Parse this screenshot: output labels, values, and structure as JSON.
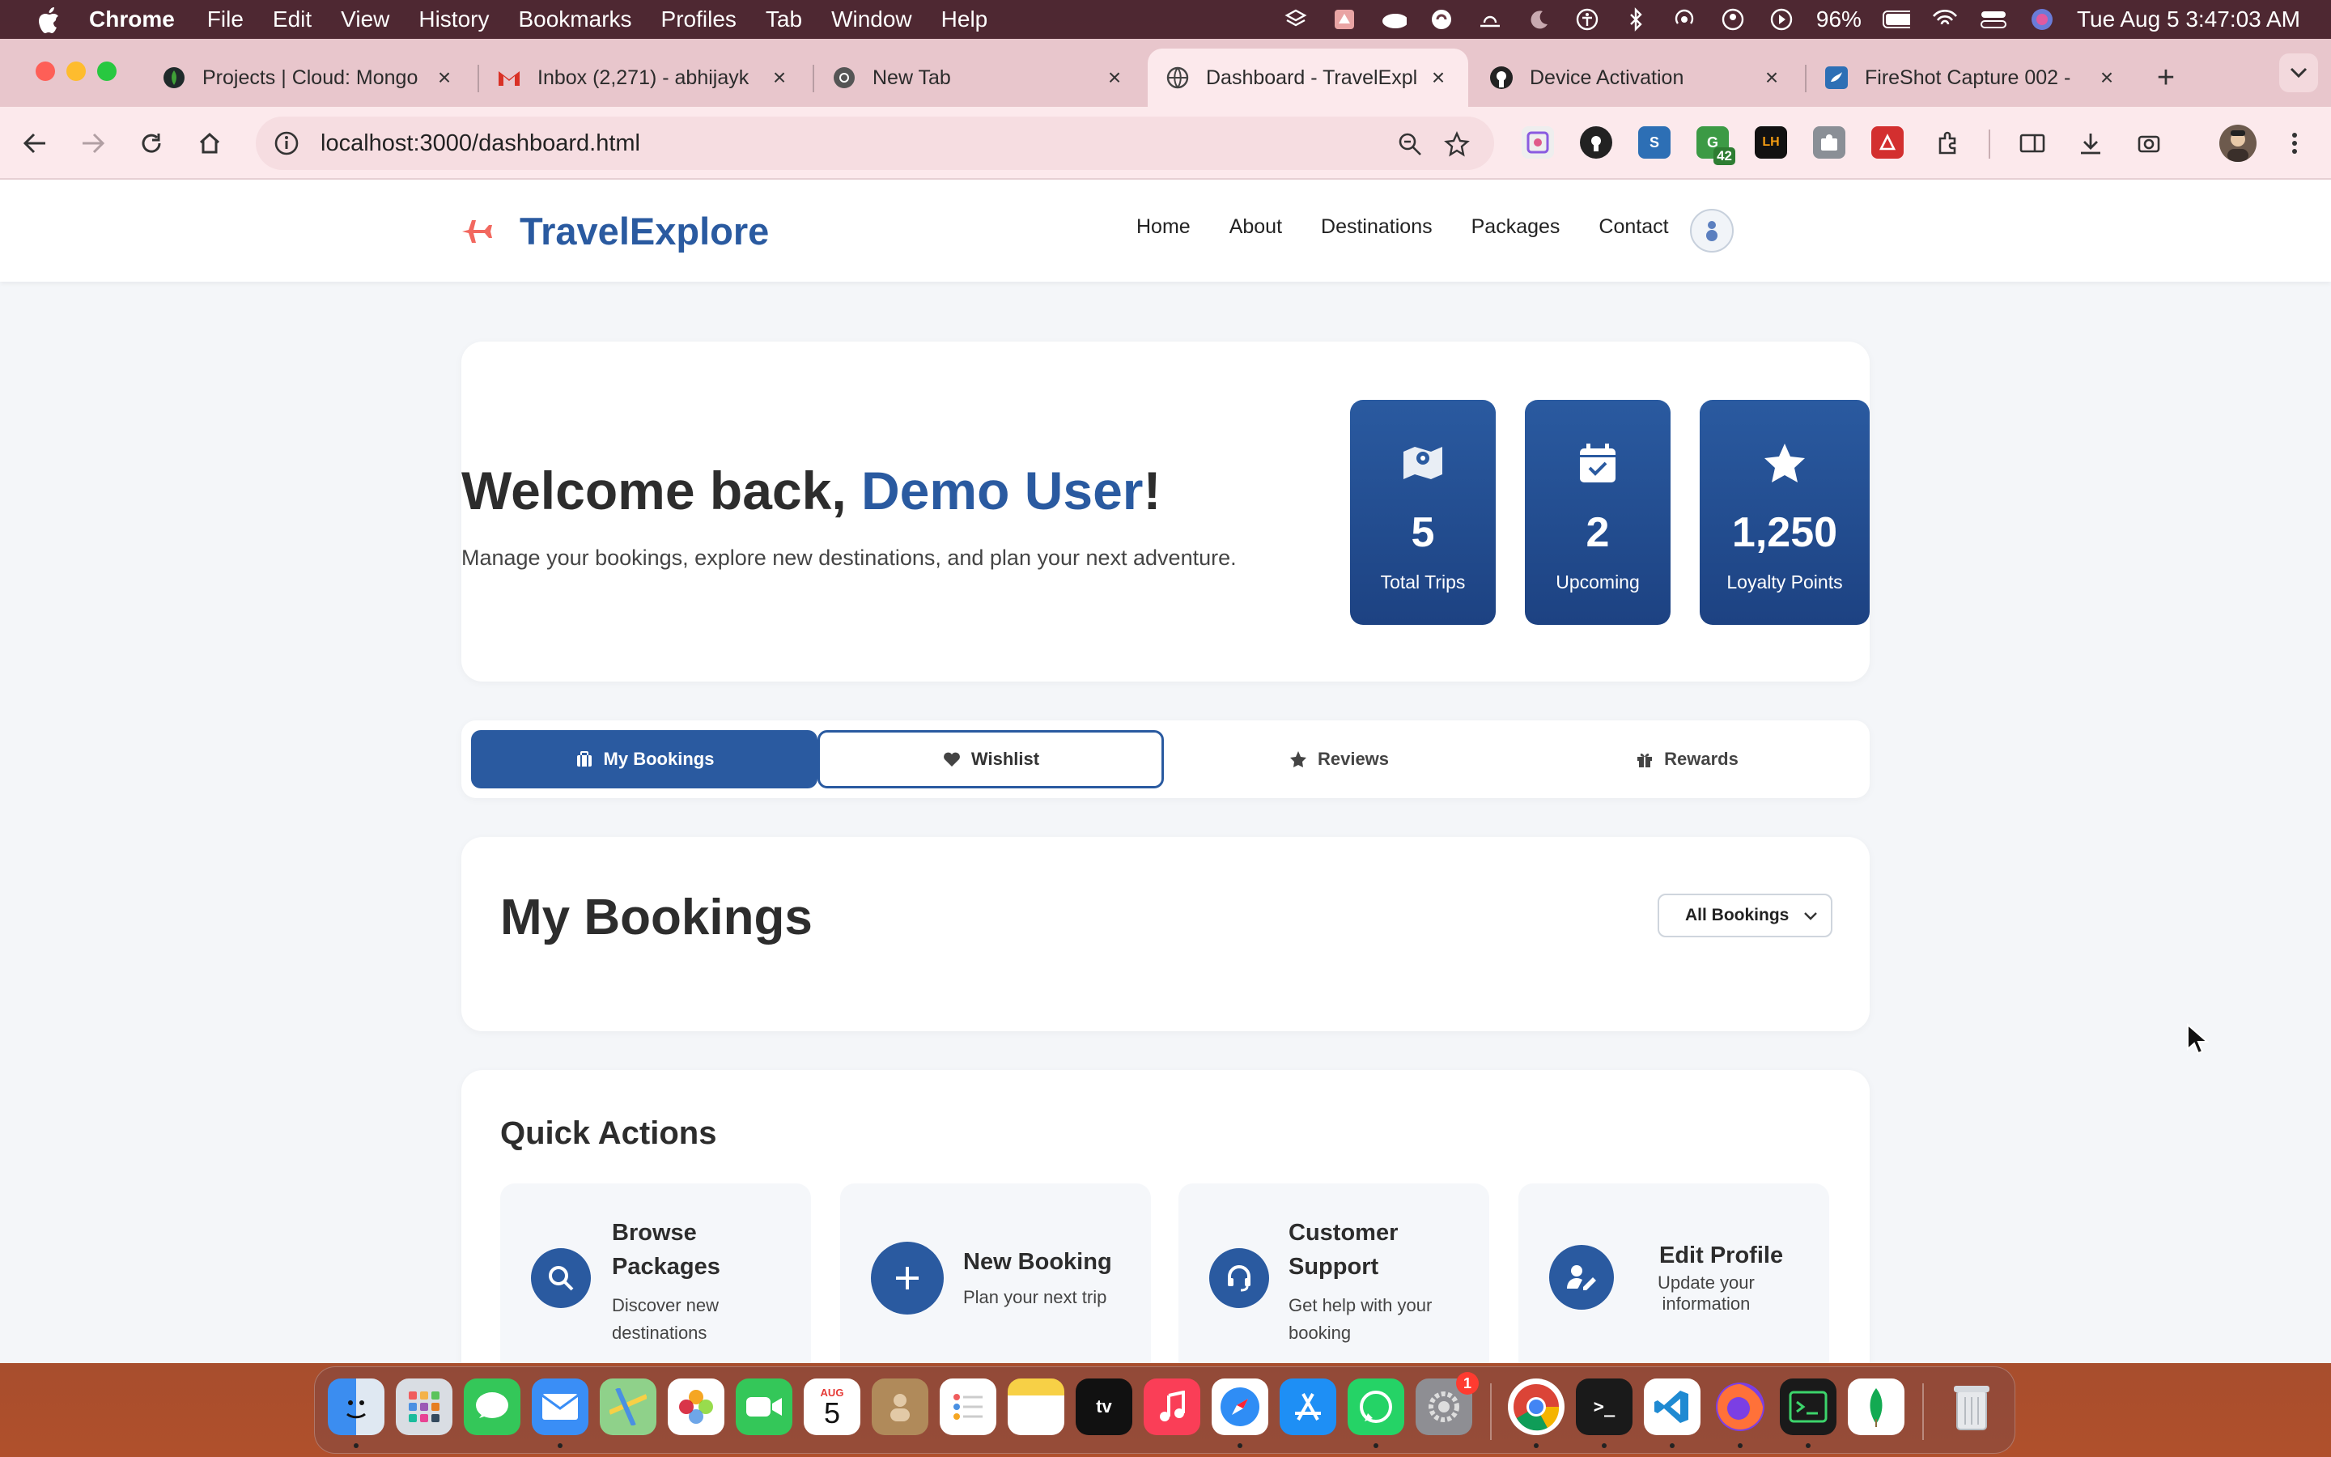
{
  "menubar": {
    "app": "Chrome",
    "items": [
      "File",
      "Edit",
      "View",
      "History",
      "Bookmarks",
      "Profiles",
      "Tab",
      "Window",
      "Help"
    ],
    "battery": "96%",
    "datetime": "Tue Aug 5  3:47:03 AM"
  },
  "browser": {
    "tabs": [
      {
        "title": "Projects | Cloud: Mongo",
        "icon": "mongodb-leaf-icon"
      },
      {
        "title": "Inbox (2,271) - abhijayk",
        "icon": "gmail-icon"
      },
      {
        "title": "New Tab",
        "icon": "chrome-icon"
      },
      {
        "title": "Dashboard - TravelExpl",
        "icon": "globe-icon",
        "active": true
      },
      {
        "title": "Device Activation",
        "icon": "github-icon"
      },
      {
        "title": "FireShot Capture 002 -",
        "icon": "fireshot-icon"
      }
    ],
    "url": "localhost:3000/dashboard.html",
    "extension_badge": "42"
  },
  "site": {
    "brand": "TravelExplore",
    "nav": [
      "Home",
      "About",
      "Destinations",
      "Packages",
      "Contact"
    ],
    "accent": "#2a5aa0"
  },
  "welcome": {
    "prefix": "Welcome back, ",
    "user": "Demo User",
    "suffix": "!",
    "subtitle": "Manage your bookings, explore new destinations, and plan your next adventure."
  },
  "stats": [
    {
      "value": "5",
      "label": "Total Trips",
      "icon": "map-pin-icon"
    },
    {
      "value": "2",
      "label": "Upcoming",
      "icon": "calendar-check-icon"
    },
    {
      "value": "1,250",
      "label": "Loyalty Points",
      "icon": "star-icon"
    }
  ],
  "dashboard_tabs": [
    {
      "label": "My Bookings",
      "icon": "suitcase-icon",
      "state": "active"
    },
    {
      "label": "Wishlist",
      "icon": "heart-icon",
      "state": "focused"
    },
    {
      "label": "Reviews",
      "icon": "star-icon",
      "state": "normal"
    },
    {
      "label": "Rewards",
      "icon": "gift-icon",
      "state": "normal"
    }
  ],
  "bookings": {
    "title": "My Bookings",
    "filter_selected": "All Bookings"
  },
  "quick_actions": {
    "title": "Quick Actions",
    "items": [
      {
        "title_l1": "Browse",
        "title_l2": "Packages",
        "desc_l1": "Discover new",
        "desc_l2": "destinations",
        "icon": "search-icon"
      },
      {
        "title_l1": "New Booking",
        "title_l2": "",
        "desc_l1": "Plan your next trip",
        "desc_l2": "",
        "icon": "plus-icon"
      },
      {
        "title_l1": "Customer",
        "title_l2": "Support",
        "desc_l1": "Get help with your",
        "desc_l2": "booking",
        "icon": "headset-icon"
      },
      {
        "title_l1": "Edit Profile",
        "title_l2": "",
        "desc_l1": "Update your",
        "desc_l2": "information",
        "icon": "user-edit-icon"
      }
    ]
  },
  "dock": {
    "apps": [
      "Finder",
      "Launchpad",
      "Messages",
      "Mail",
      "Maps",
      "Photos",
      "FaceTime",
      "Calendar",
      "Contacts",
      "Reminders",
      "Notes",
      "TV",
      "Music",
      "Safari",
      "App Store",
      "WhatsApp",
      "System Settings",
      "Chrome",
      "Terminal",
      "VS Code",
      "Firefox",
      "Terminal Alt",
      "MongoDB Compass",
      "Trash"
    ],
    "calendar_month": "AUG",
    "calendar_day": "5",
    "settings_badge": "1"
  }
}
